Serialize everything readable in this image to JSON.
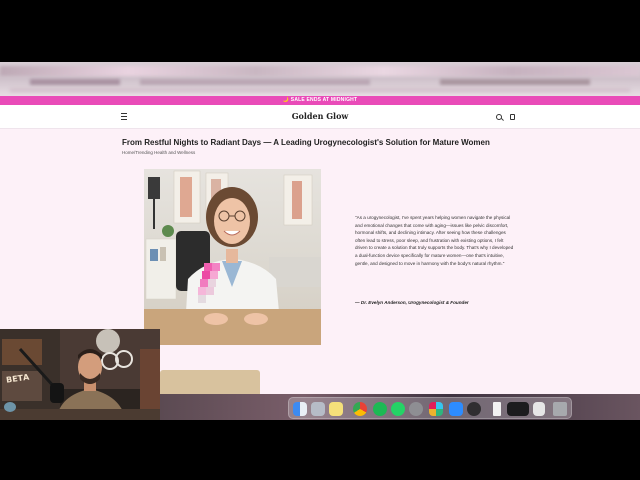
{
  "sale_bar": {
    "text": "🌙 SALE ENDS AT MIDNIGHT"
  },
  "header": {
    "logo": "Golden Glow"
  },
  "article": {
    "title": "From Restful Nights to Radiant Days — A Leading Urogynecologist's Solution for Mature Women",
    "breadcrumb": "Home/Trending Health and Wellness",
    "quote": "\"As a urogynecologist, I've spent years helping women navigate the physical and emotional changes that come with aging—issues like pelvic discomfort, hormonal shifts, and declining intimacy. After seeing how these challenges often lead to stress, poor sleep, and frustration with existing options, I felt driven to create a solution that truly supports the body. That's why I developed a dual-function device specifically for mature women—one that's intuitive, gentle, and designed to move in harmony with the body's natural rhythm.\"",
    "author": "— Dr. Evelyn Anderson, Urogynecologist & Founder"
  },
  "webcam": {
    "sign_text": "ВЕТА"
  },
  "dock": {
    "apps": [
      "finder-icon",
      "launchpad-icon",
      "notes-icon",
      "chrome-icon",
      "spotify-icon",
      "whatsapp-icon",
      "settings-icon",
      "slack-icon",
      "zoom-icon",
      "obs-icon",
      "file-icon",
      "screen-icon",
      "app-icon",
      "trash-icon"
    ]
  },
  "colors": {
    "sale_bar": "#e94bb8",
    "content_bg": "#fdf1f8",
    "header_bg": "#ffffff"
  }
}
